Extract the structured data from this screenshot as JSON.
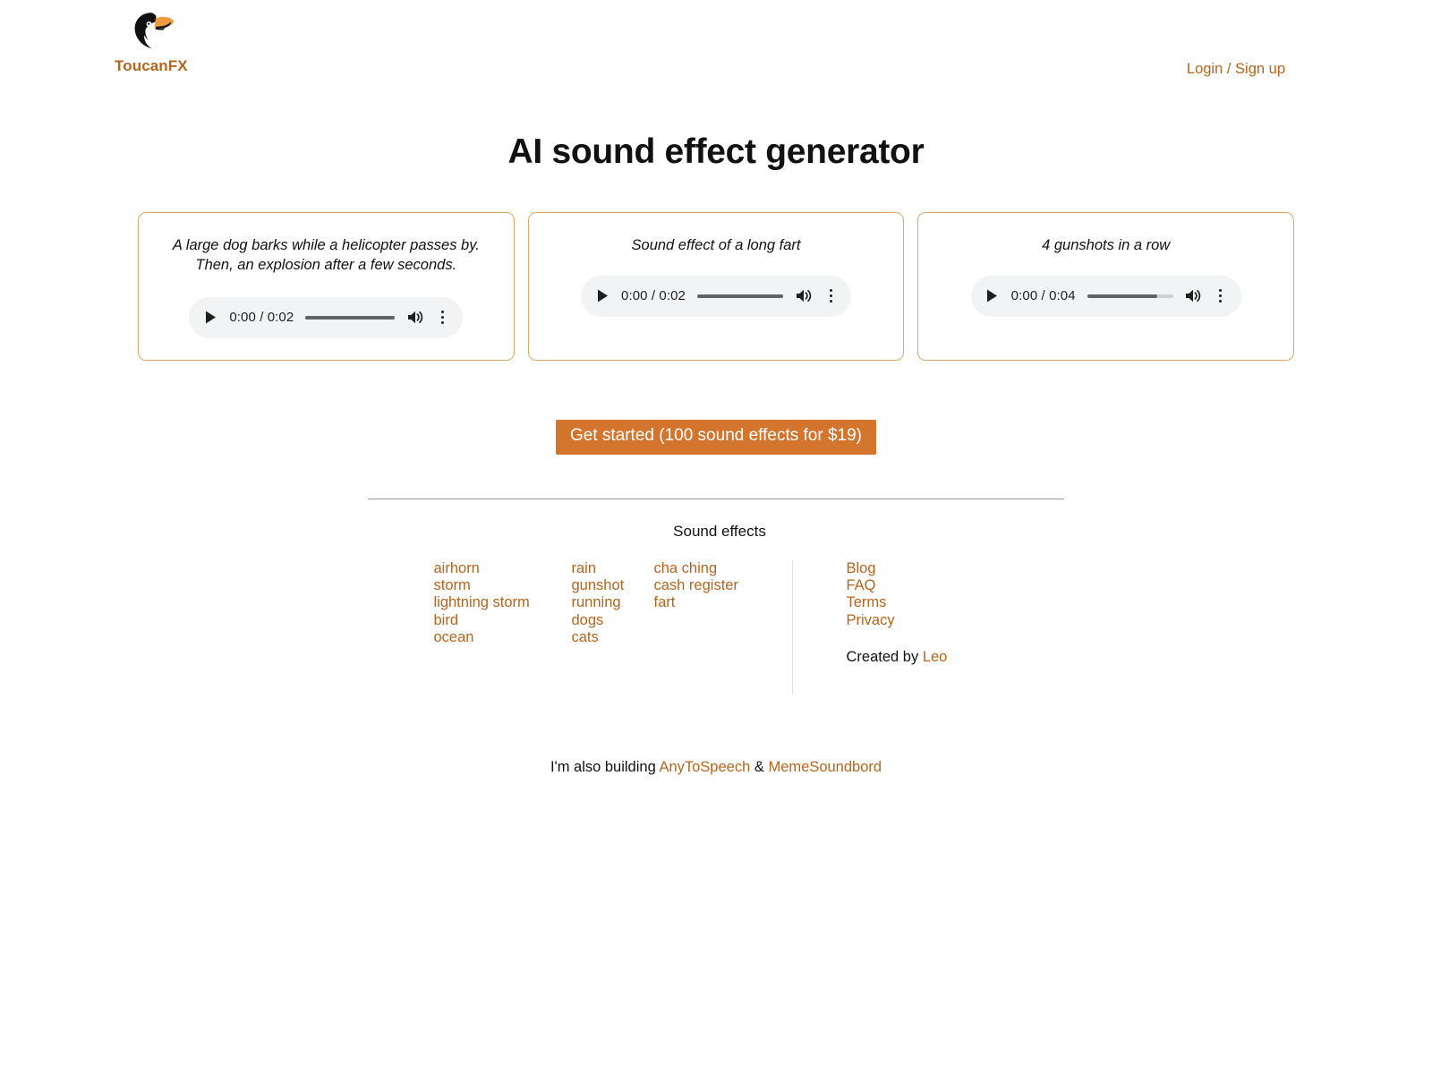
{
  "brand": {
    "name": "ToucanFX",
    "logo_icon": "toucan-icon",
    "accent_color": "#b5651d",
    "beak_color": "#f09a42"
  },
  "header": {
    "auth_link": "Login / Sign up"
  },
  "hero": {
    "title": "AI sound effect generator"
  },
  "samples": [
    {
      "caption": "A large dog barks while a helicopter passes by. Then, an explosion after a few seconds.",
      "player": {
        "play_icon": "play-icon",
        "time": "0:00 / 0:02",
        "current_time": "0:00",
        "duration": "0:02",
        "progress_percent": 100,
        "volume_icon": "volume-high-icon",
        "menu_icon": "more-vertical-icon"
      }
    },
    {
      "caption": "Sound effect of a long fart",
      "player": {
        "play_icon": "play-icon",
        "time": "0:00 / 0:02",
        "current_time": "0:00",
        "duration": "0:02",
        "progress_percent": 100,
        "volume_icon": "volume-high-icon",
        "menu_icon": "more-vertical-icon"
      }
    },
    {
      "caption": "4 gunshots in a row",
      "player": {
        "play_icon": "play-icon",
        "time": "0:00 / 0:04",
        "current_time": "0:00",
        "duration": "0:04",
        "progress_percent": 82,
        "volume_icon": "volume-high-icon",
        "menu_icon": "more-vertical-icon"
      }
    }
  ],
  "cta": {
    "label": "Get started (100 sound effects for $19)",
    "background_color": "#d4752e",
    "text_color": "#ffffff"
  },
  "footer": {
    "heading": "Sound effects",
    "sound_effect_columns": [
      [
        "airhorn",
        "storm",
        "lightning storm",
        "bird",
        "ocean"
      ],
      [
        "rain",
        "gunshot",
        "running",
        "dogs",
        "cats"
      ],
      [
        "cha ching",
        "cash register",
        "fart"
      ]
    ],
    "links": [
      "Blog",
      "FAQ",
      "Terms",
      "Privacy"
    ],
    "created_by_prefix": "Created by",
    "created_by_name": "Leo"
  },
  "also_building": {
    "prefix": "I'm also building",
    "first": "AnyToSpeech",
    "separator": "&",
    "second": "MemeSoundbord"
  }
}
